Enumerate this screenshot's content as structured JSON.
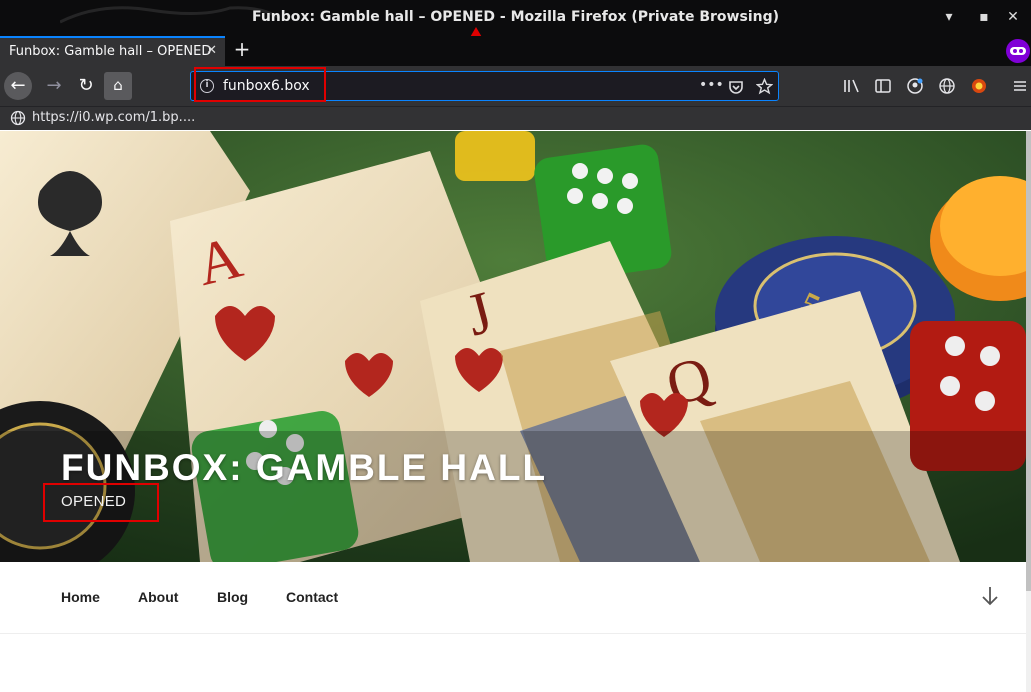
{
  "window": {
    "title": "Funbox: Gamble hall – OPENED - Mozilla Firefox (Private Browsing)",
    "controls": {
      "minimize": "▾",
      "maximize": "▪",
      "close": "✕"
    }
  },
  "tabs": [
    {
      "label": "Funbox: Gamble hall – OPENED",
      "close": "✕"
    }
  ],
  "newtab_label": "+",
  "toolbar": {
    "back": "←",
    "forward": "→",
    "reload": "↻",
    "home": "⌂",
    "url": "funbox6.box",
    "page_actions": "•••",
    "info": "i",
    "icons": [
      "library-icon",
      "sidebar-icon",
      "account-icon",
      "globe-extension-icon",
      "extension-icon",
      "menu-icon"
    ]
  },
  "status": {
    "link_url": "https://i0.wp.com/1.bp...."
  },
  "site": {
    "title": "FUNBOX: GAMBLE HALL",
    "tagline": "OPENED",
    "menu": [
      "Home",
      "About",
      "Blog",
      "Contact"
    ]
  },
  "colors": {
    "annotation_red": "#e00000",
    "firefox_blue": "#0a84ff",
    "private_purple": "#8000d7"
  }
}
